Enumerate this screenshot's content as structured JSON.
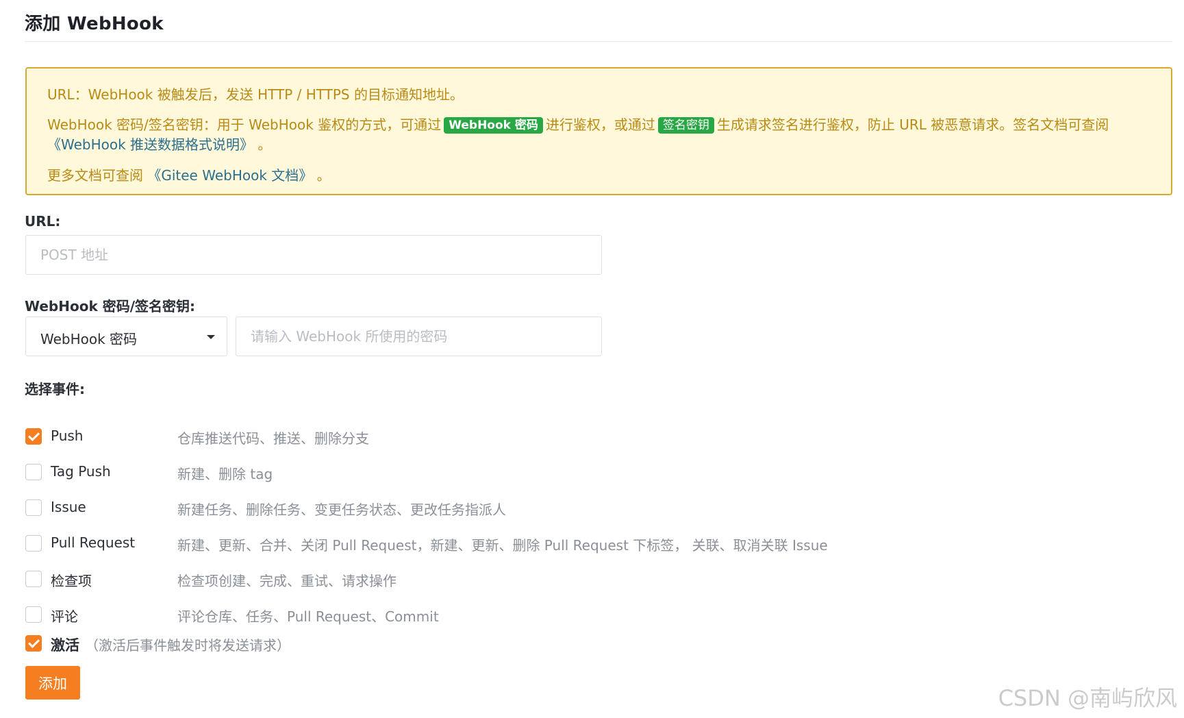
{
  "page": {
    "title": "添加 WebHook"
  },
  "notice": {
    "line1": "URL：WebHook 被触发后，发送 HTTP / HTTPS 的目标通知地址。",
    "line2_part1": "WebHook 密码/签名密钥：用于 WebHook 鉴权的方式，可通过",
    "tag_password": "WebHook 密码",
    "line2_part2": "进行鉴权，或通过",
    "tag_signature": "签名密钥",
    "line2_part3": "生成请求签名进行鉴权，防止 URL 被恶意请求。签名文档可查阅",
    "format_doc_link": "《WebHook 推送数据格式说明》",
    "line3_suffix": "。",
    "line4_prefix": "更多文档可查阅",
    "gitee_doc_link": "《Gitee WebHook 文档》",
    "line4_suffix": "。"
  },
  "url_field": {
    "label": "URL:",
    "placeholder": "POST 地址",
    "value": ""
  },
  "secret_field": {
    "label": "WebHook 密码/签名密钥:",
    "select_value": "WebHook 密码",
    "placeholder": "请输入 WebHook 所使用的密码",
    "value": ""
  },
  "events": {
    "label": "选择事件:",
    "items": [
      {
        "name": "Push",
        "desc": "仓库推送代码、推送、删除分支",
        "checked": true
      },
      {
        "name": "Tag Push",
        "desc": "新建、删除 tag",
        "checked": false
      },
      {
        "name": "Issue",
        "desc": "新建任务、删除任务、变更任务状态、更改任务指派人",
        "checked": false
      },
      {
        "name": "Pull Request",
        "desc": "新建、更新、合并、关闭 Pull Request，新建、更新、删除 Pull Request 下标签， 关联、取消关联 Issue",
        "checked": false
      },
      {
        "name": "检查项",
        "desc": "检查项创建、完成、重试、请求操作",
        "checked": false
      },
      {
        "name": "评论",
        "desc": "评论仓库、任务、Pull Request、Commit",
        "checked": false
      }
    ]
  },
  "activate": {
    "label": "激活",
    "hint": "（激活后事件触发时将发送请求）",
    "checked": true
  },
  "submit": {
    "label": "添加"
  },
  "watermark": "CSDN @南屿欣风",
  "colors": {
    "accent": "#f57e20",
    "notice_bg": "#fff8db",
    "notice_border": "#d6a935",
    "notice_text": "#b98a14",
    "tag_green": "#28a745",
    "link": "#2b6f8f"
  },
  "icons": {
    "checkbox_checked": "checkmark-icon",
    "select_caret": "caret-down-icon"
  }
}
